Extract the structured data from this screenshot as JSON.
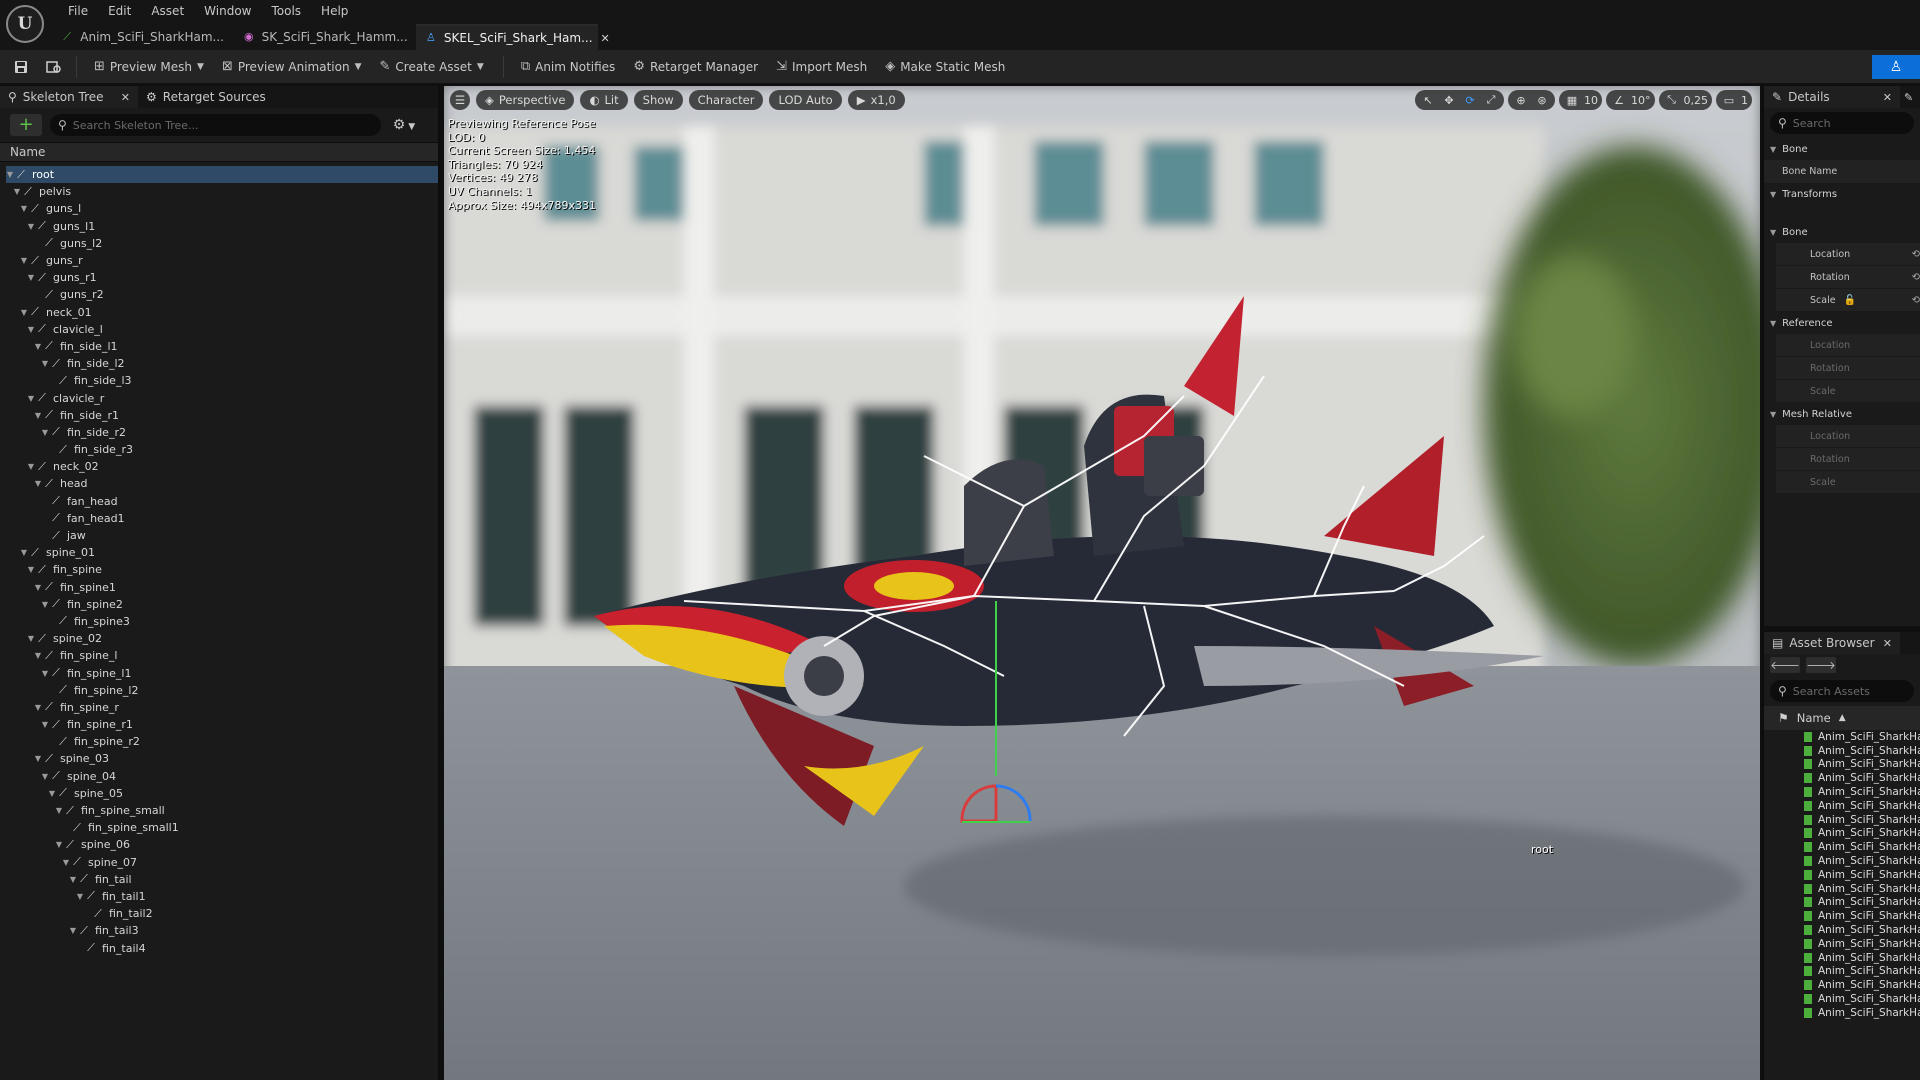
{
  "menu": [
    "File",
    "Edit",
    "Asset",
    "Window",
    "Tools",
    "Help"
  ],
  "tabs": [
    {
      "label": "Anim_SciFi_SharkHam...",
      "icon": "animation-sequence-icon"
    },
    {
      "label": "SK_SciFi_Shark_Hamm...",
      "icon": "skeletal-mesh-icon"
    },
    {
      "label": "SKEL_SciFi_Shark_Ham...",
      "icon": "skeleton-icon",
      "active": true
    }
  ],
  "toolbar": {
    "preview_mesh": "Preview Mesh",
    "preview_animation": "Preview Animation",
    "create_asset": "Create Asset",
    "anim_notifies": "Anim Notifies",
    "retarget_manager": "Retarget Manager",
    "import_mesh": "Import Mesh",
    "make_static_mesh": "Make Static Mesh"
  },
  "left_panel": {
    "tab_skeleton_tree": "Skeleton Tree",
    "tab_retarget_sources": "Retarget Sources",
    "search_placeholder": "Search Skeleton Tree...",
    "column_name": "Name"
  },
  "bones": [
    {
      "name": "root",
      "depth": 0,
      "expanded": true,
      "selected": true
    },
    {
      "name": "pelvis",
      "depth": 1,
      "expanded": true
    },
    {
      "name": "guns_l",
      "depth": 2,
      "expanded": true
    },
    {
      "name": "guns_l1",
      "depth": 3,
      "expanded": true
    },
    {
      "name": "guns_l2",
      "depth": 4
    },
    {
      "name": "guns_r",
      "depth": 2,
      "expanded": true
    },
    {
      "name": "guns_r1",
      "depth": 3,
      "expanded": true
    },
    {
      "name": "guns_r2",
      "depth": 4
    },
    {
      "name": "neck_01",
      "depth": 2,
      "expanded": true
    },
    {
      "name": "clavicle_l",
      "depth": 3,
      "expanded": true
    },
    {
      "name": "fin_side_l1",
      "depth": 4,
      "expanded": true
    },
    {
      "name": "fin_side_l2",
      "depth": 5,
      "expanded": true
    },
    {
      "name": "fin_side_l3",
      "depth": 6
    },
    {
      "name": "clavicle_r",
      "depth": 3,
      "expanded": true
    },
    {
      "name": "fin_side_r1",
      "depth": 4,
      "expanded": true
    },
    {
      "name": "fin_side_r2",
      "depth": 5,
      "expanded": true
    },
    {
      "name": "fin_side_r3",
      "depth": 6
    },
    {
      "name": "neck_02",
      "depth": 3,
      "expanded": true
    },
    {
      "name": "head",
      "depth": 4,
      "expanded": true
    },
    {
      "name": "fan_head",
      "depth": 5
    },
    {
      "name": "fan_head1",
      "depth": 5
    },
    {
      "name": "jaw",
      "depth": 5
    },
    {
      "name": "spine_01",
      "depth": 2,
      "expanded": true
    },
    {
      "name": "fin_spine",
      "depth": 3,
      "expanded": true
    },
    {
      "name": "fin_spine1",
      "depth": 4,
      "expanded": true
    },
    {
      "name": "fin_spine2",
      "depth": 5,
      "expanded": true
    },
    {
      "name": "fin_spine3",
      "depth": 6
    },
    {
      "name": "spine_02",
      "depth": 3,
      "expanded": true
    },
    {
      "name": "fin_spine_l",
      "depth": 4,
      "expanded": true
    },
    {
      "name": "fin_spine_l1",
      "depth": 5,
      "expanded": true
    },
    {
      "name": "fin_spine_l2",
      "depth": 6
    },
    {
      "name": "fin_spine_r",
      "depth": 4,
      "expanded": true
    },
    {
      "name": "fin_spine_r1",
      "depth": 5,
      "expanded": true
    },
    {
      "name": "fin_spine_r2",
      "depth": 6
    },
    {
      "name": "spine_03",
      "depth": 4,
      "expanded": true
    },
    {
      "name": "spine_04",
      "depth": 5,
      "expanded": true
    },
    {
      "name": "spine_05",
      "depth": 6,
      "expanded": true
    },
    {
      "name": "fin_spine_small",
      "depth": 7,
      "expanded": true
    },
    {
      "name": "fin_spine_small1",
      "depth": 8
    },
    {
      "name": "spine_06",
      "depth": 7,
      "expanded": true
    },
    {
      "name": "spine_07",
      "depth": 8,
      "expanded": true
    },
    {
      "name": "fin_tail",
      "depth": 9,
      "expanded": true
    },
    {
      "name": "fin_tail1",
      "depth": 10,
      "expanded": true
    },
    {
      "name": "fin_tail2",
      "depth": 11
    },
    {
      "name": "fin_tail3",
      "depth": 9,
      "expanded": true
    },
    {
      "name": "fin_tail4",
      "depth": 10
    }
  ],
  "viewport": {
    "perspective": "Perspective",
    "lit": "Lit",
    "show": "Show",
    "character": "Character",
    "lod": "LOD Auto",
    "play_speed": "x1,0",
    "grid_snap": "10",
    "rot_snap": "10°",
    "scale_snap": "0,25",
    "camera_speed": "1",
    "stats": [
      "Previewing Reference Pose",
      "LOD: 0",
      "Current Screen Size: 1,454",
      "Triangles: 70 924",
      "Vertices: 49 278",
      "UV Channels: 1",
      "Approx Size: 494x789x331"
    ],
    "root_label": "root"
  },
  "details": {
    "title": "Details",
    "search_placeholder": "Search",
    "cat_bone": "Bone",
    "bone_name": "Bone Name",
    "cat_transforms": "Transforms",
    "sub_bone": "Bone",
    "location": "Location",
    "rotation": "Rotation",
    "scale": "Scale",
    "sub_reference": "Reference",
    "sub_mesh_relative": "Mesh Relative"
  },
  "asset_browser": {
    "title": "Asset Browser",
    "search_placeholder": "Search Assets",
    "column_name": "Name",
    "item_label": "Anim_SciFi_SharkHa",
    "count": 21
  }
}
